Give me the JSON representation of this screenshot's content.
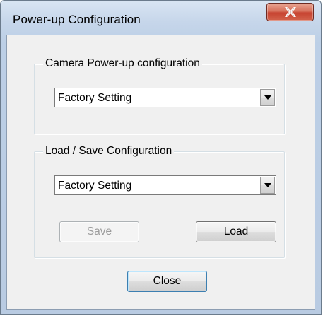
{
  "window": {
    "title": "Power-up Configuration"
  },
  "camera_group": {
    "label": "Camera Power-up configuration",
    "combo_value": "Factory Setting"
  },
  "loadsave_group": {
    "label": "Load / Save Configuration",
    "combo_value": "Factory Setting",
    "save_label": "Save",
    "load_label": "Load"
  },
  "footer": {
    "close_label": "Close"
  },
  "icons": {
    "window_close": "close-icon",
    "dropdown": "chevron-down-icon"
  },
  "colors": {
    "titlebar": "#c6d6ea",
    "close_button": "#c74331",
    "client_bg": "#f0f0f0"
  }
}
